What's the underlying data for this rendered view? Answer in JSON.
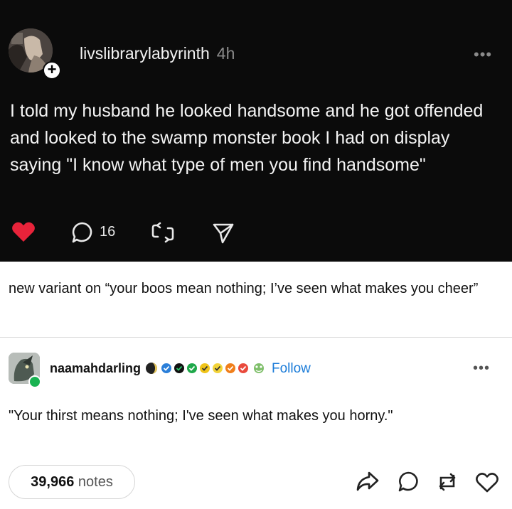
{
  "dark_post": {
    "blog_name": "livslibrarylabyrinth",
    "time": "4h",
    "text": "I told my husband he looked handsome and he got offended and looked to the swamp monster book I had on display saying \"I know what type of men you find handsome\"",
    "reply_count": "16",
    "colors": {
      "background": "#0b0b0b",
      "heart": "#e8233a",
      "text": "#f4f4f4"
    },
    "icons": [
      "plus-icon",
      "more-icon",
      "heart-icon",
      "reply-icon",
      "reblog-icon",
      "share-icon"
    ]
  },
  "quote_comment": "new variant on “your boos mean nothing; I’ve seen what makes you cheer”",
  "reblog": {
    "blog_name": "naamahdarling",
    "follow_label": "Follow",
    "text": "\"Your thirst means nothing; I've seen what makes you horny.\"",
    "colors": {
      "follow": "#1a7bd8",
      "reblog_badge": "#19b352"
    }
  },
  "footer": {
    "notes_count": "39,966",
    "notes_label": "notes",
    "icons": [
      "share-icon",
      "reply-icon",
      "reblog-icon",
      "heart-icon"
    ]
  }
}
